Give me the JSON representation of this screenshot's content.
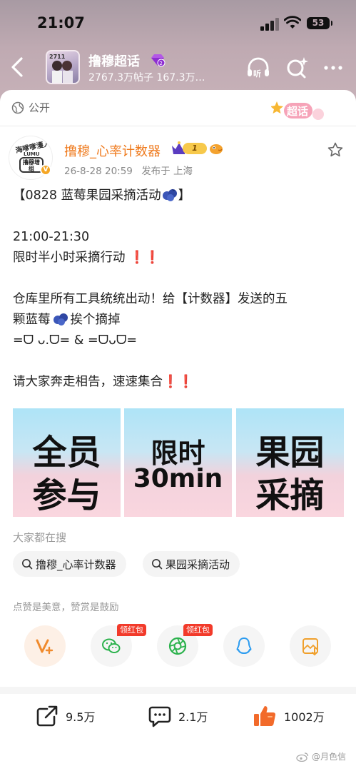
{
  "status_bar": {
    "time": "21:07",
    "battery": "53"
  },
  "nav": {
    "title": "撸穆超话",
    "subtitle": "2767.3万帖子 167.3万…"
  },
  "post": {
    "visibility": "公开",
    "badge": "超话",
    "author": {
      "name": "撸穆_心率计数器",
      "level": "1",
      "avatar_text_top": "海嗲嗲濩人",
      "avatar_text_mid": "LUMU",
      "avatar_text_box": "撸穆增组"
    },
    "date": "26-8-28 20:59",
    "location": "发布于 上海",
    "lines": {
      "l1": "【0828 蓝莓果园采摘活动",
      "l1_end": "】",
      "l3": "21:00-21:30",
      "l4": "限时半小时采摘行动",
      "l6": "仓库里所有工具统统出动！给【计数器】发送的五",
      "l7a": "颗蓝莓",
      "l7b": "挨个摘掉",
      "l8": "=ᗜ ᴗ.ᗜ= & =ᗜᴗᗜ=",
      "l10": "请大家奔走相告，速速集合",
      "exclaim": "❗❗"
    },
    "images": [
      {
        "line1": "全员",
        "line2": "参与"
      },
      {
        "line1": "限时",
        "line2": "30min"
      },
      {
        "line1": "果园",
        "line2": "采摘"
      }
    ],
    "search_heading": "大家都在搜",
    "search_chips": [
      "撸穆_心率计数器",
      "果园采摘活动"
    ],
    "reward_hint": "点赞是美意，赞赏是鼓励",
    "red_packet_tag": "领红包"
  },
  "actions": {
    "repost": "9.5万",
    "comment": "2.1万",
    "like": "1002万"
  },
  "watermark": "@月色信",
  "colors": {
    "accent_orange": "#ef7a1d",
    "alert_red": "#e02020",
    "like_orange": "#f26a2a"
  }
}
